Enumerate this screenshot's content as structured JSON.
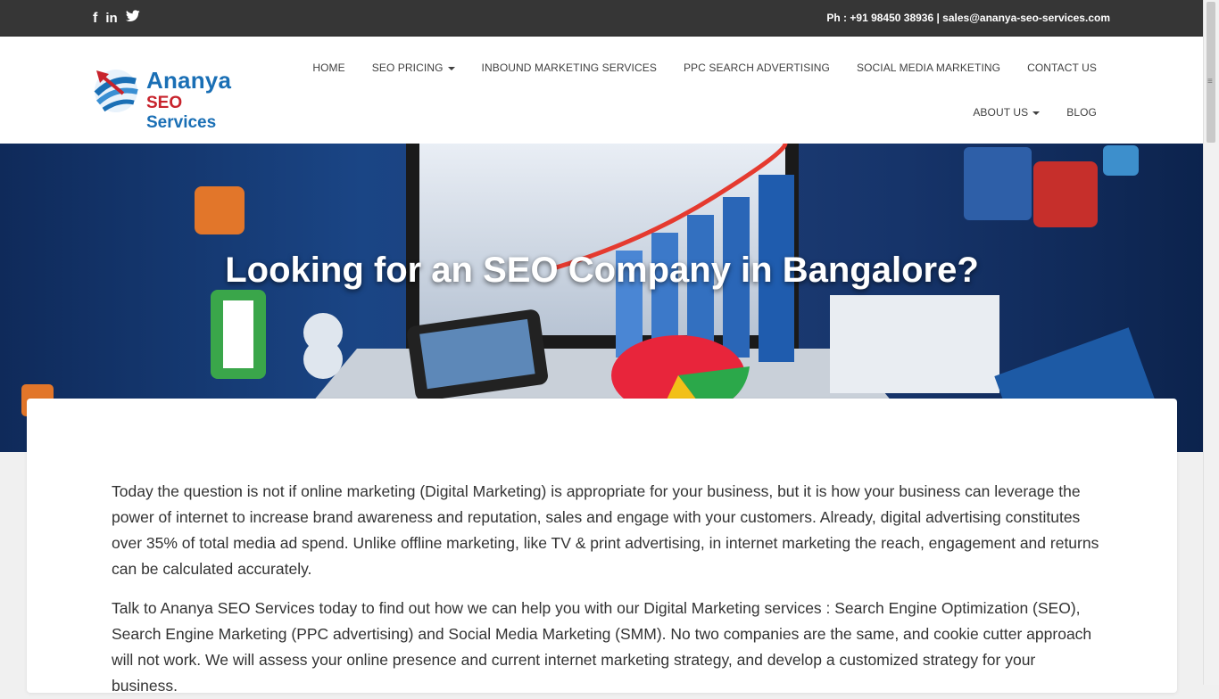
{
  "topbar": {
    "social": {
      "facebook_glyph": "f",
      "linkedin_glyph": "in",
      "twitter_glyph": "🐦"
    },
    "contact_text": "Ph : +91 98450 38936 | sales@ananya-seo-services.com"
  },
  "logo": {
    "line1": "Ananya",
    "line2_part1": "SEO",
    "line2_part2": "Services"
  },
  "nav": {
    "row1": [
      "HOME",
      "SEO PRICING",
      "INBOUND MARKETING SERVICES",
      "PPC SEARCH ADVERTISING",
      "SOCIAL MEDIA MARKETING",
      "CONTACT US"
    ],
    "row2": [
      "ABOUT US",
      "BLOG"
    ]
  },
  "hero": {
    "title": "Looking for an SEO Company in Bangalore?"
  },
  "content": {
    "p1": "Today the question is not if online marketing (Digital Marketing) is appropriate for your business, but it is how your business can leverage the power of internet to increase brand awareness and reputation, sales and engage with your customers. Already, digital advertising constitutes over 35% of total media ad spend. Unlike offline marketing, like TV & print advertising, in internet marketing the reach, engagement and returns can be calculated accurately.",
    "p2": "Talk to Ananya SEO Services today to find out how we can help you with our Digital Marketing services : Search Engine Optimization (SEO), Search Engine Marketing (PPC advertising) and Social Media Marketing (SMM). No two companies are the same, and cookie cutter approach will not work. We will assess your online presence and current internet marketing strategy, and develop a customized strategy for your business."
  },
  "colors": {
    "topbar_bg": "#363636",
    "brand_blue": "#1a6fb5",
    "brand_red": "#c8232c",
    "nav_text": "#404040"
  }
}
